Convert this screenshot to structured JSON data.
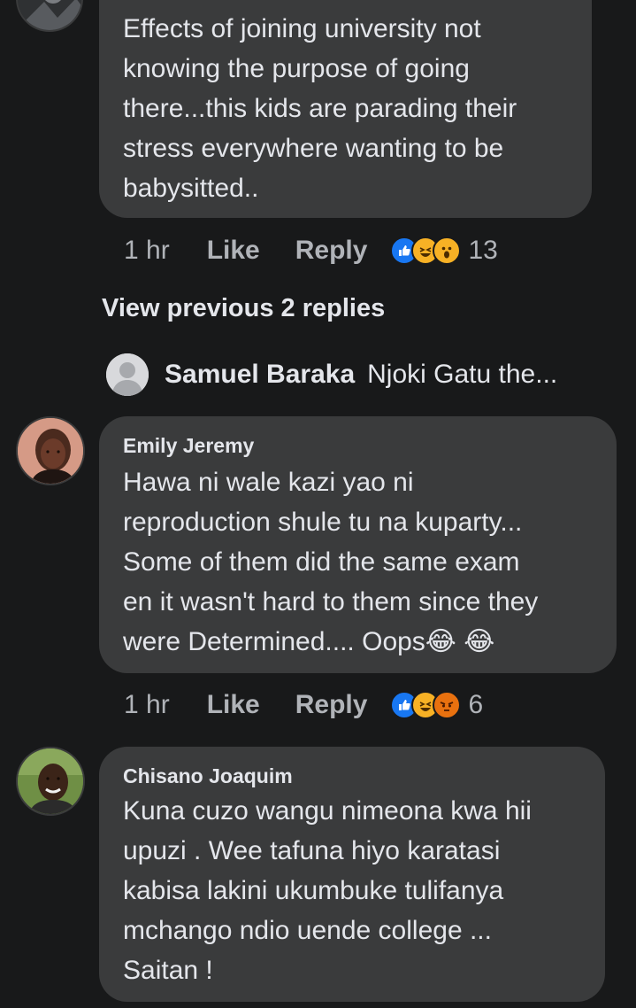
{
  "comments": [
    {
      "author": "",
      "lines": [
        "Effects of joining university not",
        "knowing the purpose of going",
        "there...this kids are parading their",
        "stress everywhere wanting to be",
        "babysitted.."
      ],
      "time": "1 hr",
      "like_label": "Like",
      "reply_label": "Reply",
      "reactions": [
        "like",
        "haha",
        "wow"
      ],
      "reaction_count": "13"
    },
    {
      "author": "Emily Jeremy",
      "lines": [
        "Hawa ni wale kazi yao ni",
        "reproduction shule tu na kuparty...",
        "Some of them did the same exam",
        "en it wasn't hard to them since they",
        "were Determined.... Oops😂 😂"
      ],
      "time": "1 hr",
      "like_label": "Like",
      "reply_label": "Reply",
      "reactions": [
        "like",
        "haha",
        "angry"
      ],
      "reaction_count": "6"
    },
    {
      "author": "Chisano Joaquim",
      "lines": [
        "Kuna cuzo wangu nimeona kwa hii",
        "upuzi . Wee tafuna hiyo karatasi",
        "kabisa lakini  ukumbuke tulifanya",
        "mchango ndio uende college ...",
        "Saitan !"
      ]
    }
  ],
  "view_previous": "View previous 2 replies",
  "collapsed_reply": {
    "name": "Samuel Baraka",
    "snippet": "Njoki Gatu the..."
  },
  "colors": {
    "background": "#18191a",
    "bubble": "#3a3b3c",
    "text": "#e4e6eb",
    "meta_text": "#b0b3b8",
    "like_blue": "#1877f2",
    "haha_yellow": "#f7b125",
    "angry_orange": "#e9710f"
  }
}
